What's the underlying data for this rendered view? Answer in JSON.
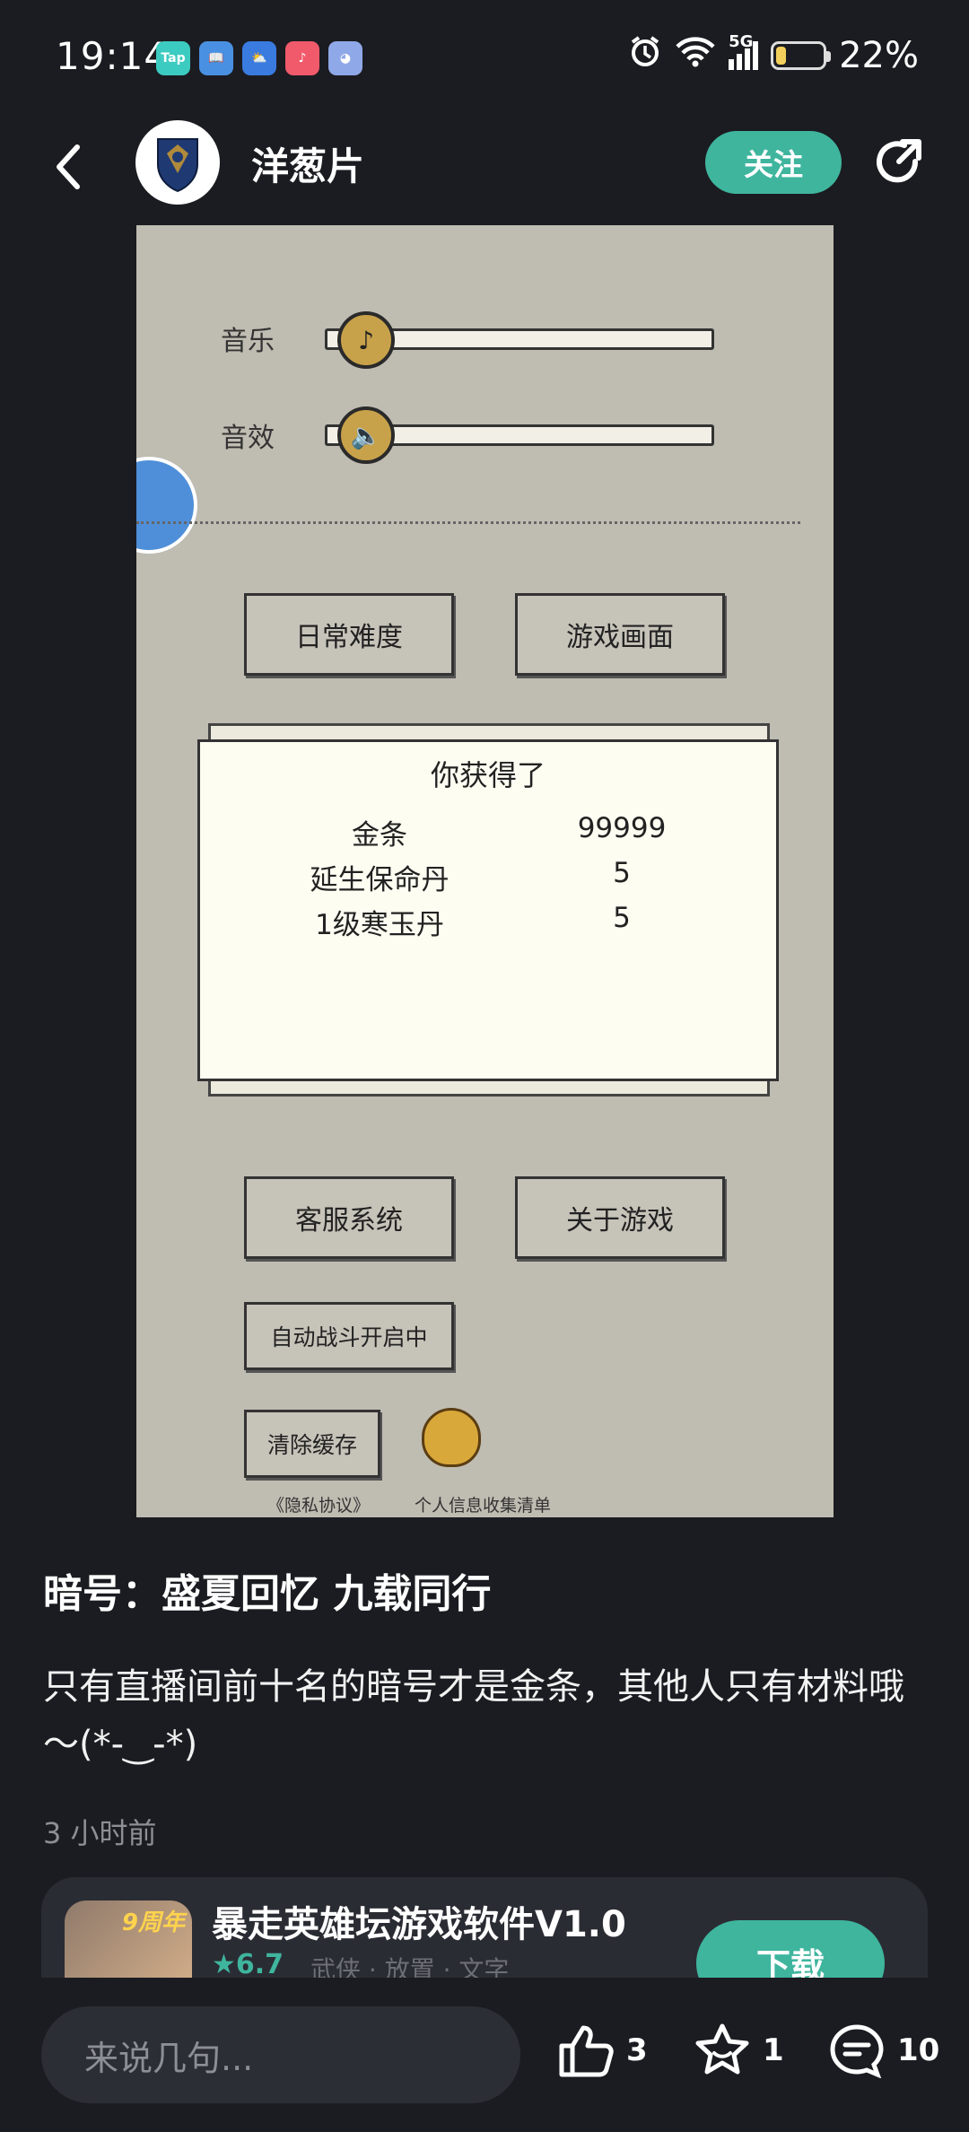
{
  "status_bar": {
    "time": "19:14",
    "app_icons": [
      {
        "name": "taptap-icon",
        "text": "Tap",
        "color": "#3ccbc0"
      },
      {
        "name": "book-icon",
        "text": "📖",
        "color": "#4a90e2"
      },
      {
        "name": "weather-icon",
        "text": "⛅",
        "color": "#3a7be0"
      },
      {
        "name": "music-icon",
        "text": "♪",
        "color": "#f05a6a"
      },
      {
        "name": "ghost-app-icon",
        "text": "◕",
        "color": "#8fa8e8"
      }
    ],
    "network": "5G",
    "battery": "22%",
    "battery_level": 0.22
  },
  "header": {
    "username": "洋葱片",
    "follow_label": "关注"
  },
  "game": {
    "music_label": "音乐",
    "sfx_label": "音效",
    "btn_daily": "日常难度",
    "btn_graphics": "游戏画面",
    "popup_title": "你获得了",
    "rewards": [
      {
        "name": "金条",
        "value": "99999"
      },
      {
        "name": "延生保命丹",
        "value": "5"
      },
      {
        "name": "1级寒玉丹",
        "value": "5"
      }
    ],
    "btn_service": "客服系统",
    "btn_about": "关于游戏",
    "btn_autobattle": "自动战斗开启中",
    "btn_clear": "清除缓存",
    "privacy": "《隐私协议》",
    "info_list": "个人信息收集清单"
  },
  "post": {
    "title": "暗号：盛夏回忆 九载同行",
    "body": "只有直播间前十名的暗号才是金条，其他人只有材料哦～(*-‿-*)",
    "time_ago": "3 小时前"
  },
  "app_card": {
    "icon_badge": "9周年",
    "name": "暴走英雄坛游戏软件V1.0",
    "rating": "★6.7",
    "tags": "武侠 · 放置 · 文字",
    "download_label": "下载"
  },
  "bottom": {
    "comment_placeholder": "来说几句...",
    "likes": "3",
    "favorites": "1",
    "comments": "10"
  }
}
